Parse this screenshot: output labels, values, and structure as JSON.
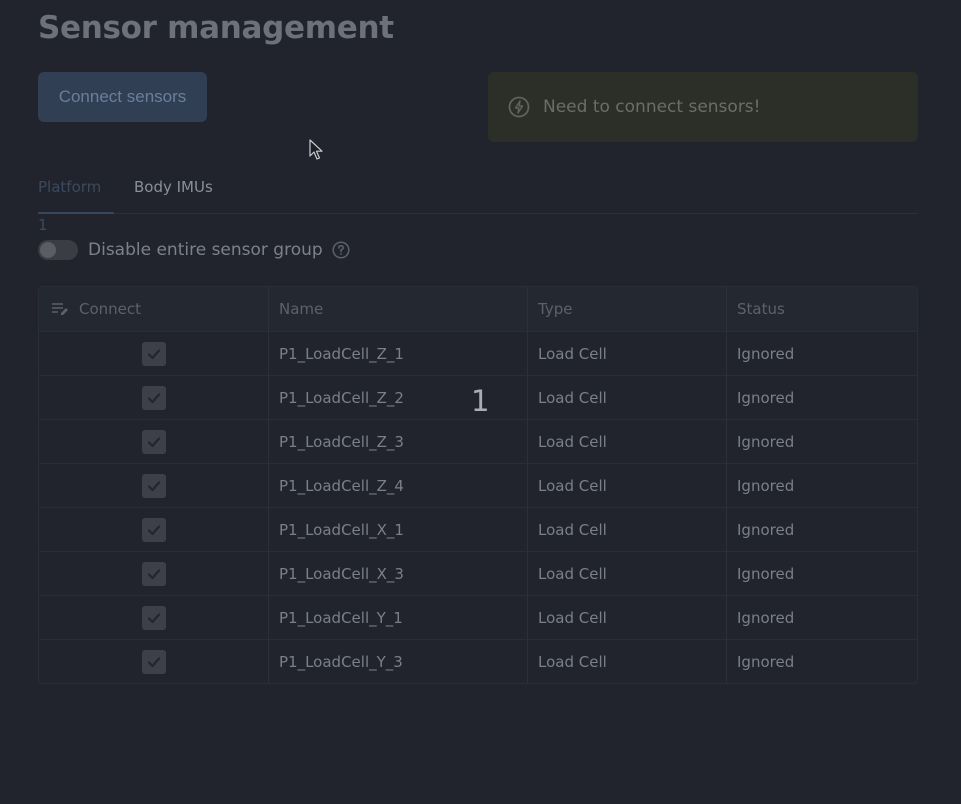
{
  "page": {
    "title": "Sensor management"
  },
  "toolbar": {
    "connect_label": "Connect sensors"
  },
  "alert": {
    "icon": "bolt-circle-icon",
    "message": "Need to connect sensors!"
  },
  "tabs": [
    {
      "label": "Platform 1",
      "active": true
    },
    {
      "label": "Body IMUs",
      "active": false
    }
  ],
  "group_toggle": {
    "label": "Disable entire sensor group",
    "on": false
  },
  "table": {
    "columns": [
      "Connect",
      "Name",
      "Type",
      "Status"
    ],
    "rows": [
      {
        "connected": true,
        "name": "P1_LoadCell_Z_1",
        "type": "Load Cell",
        "status": "Ignored"
      },
      {
        "connected": true,
        "name": "P1_LoadCell_Z_2",
        "type": "Load Cell",
        "status": "Ignored"
      },
      {
        "connected": true,
        "name": "P1_LoadCell_Z_3",
        "type": "Load Cell",
        "status": "Ignored"
      },
      {
        "connected": true,
        "name": "P1_LoadCell_Z_4",
        "type": "Load Cell",
        "status": "Ignored"
      },
      {
        "connected": true,
        "name": "P1_LoadCell_X_1",
        "type": "Load Cell",
        "status": "Ignored"
      },
      {
        "connected": true,
        "name": "P1_LoadCell_X_3",
        "type": "Load Cell",
        "status": "Ignored"
      },
      {
        "connected": true,
        "name": "P1_LoadCell_Y_1",
        "type": "Load Cell",
        "status": "Ignored"
      },
      {
        "connected": true,
        "name": "P1_LoadCell_Y_3",
        "type": "Load Cell",
        "status": "Ignored"
      }
    ]
  },
  "overlay": {
    "number": "1"
  },
  "colors": {
    "background": "#21242c",
    "primary_button": "#313f54",
    "alert_bg": "#2b2f27"
  }
}
